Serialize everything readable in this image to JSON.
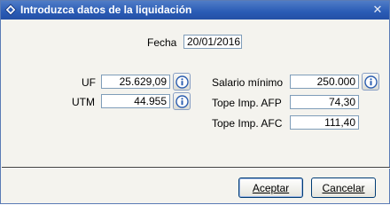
{
  "window": {
    "title": "Introduzca datos de la liquidación",
    "close_glyph": "✕",
    "icon": "app-diamond-icon"
  },
  "form": {
    "fecha": {
      "label": "Fecha",
      "value": "20/01/2016"
    },
    "uf": {
      "label": "UF",
      "value": "25.629,09"
    },
    "utm": {
      "label": "UTM",
      "value": "44.955"
    },
    "salario_minimo": {
      "label": "Salario mínimo",
      "value": "250.000"
    },
    "tope_afp": {
      "label": "Tope Imp. AFP",
      "value": "74,30"
    },
    "tope_afc": {
      "label": "Tope Imp. AFC",
      "value": "111,40"
    }
  },
  "buttons": {
    "accept": "Aceptar",
    "cancel": "Cancelar"
  },
  "icons": {
    "info": "info-icon"
  },
  "colors": {
    "titlebar": "#2a5bb5",
    "dialog_bg": "#f4f3ee",
    "field_border": "#7f9db9",
    "info_icon": "#2e5fb0"
  }
}
